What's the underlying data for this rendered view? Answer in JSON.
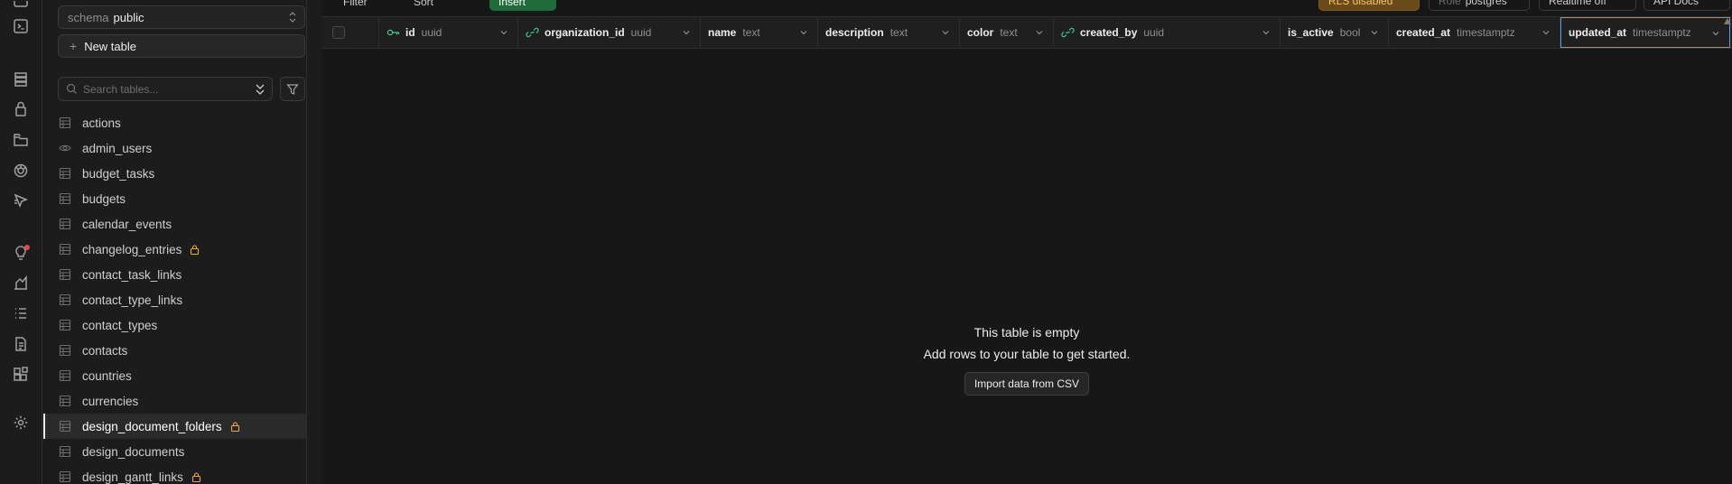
{
  "rail": {
    "icons": [
      "table-editor-icon",
      "sql-editor-icon",
      "database-icon",
      "auth-icon",
      "storage-icon",
      "realtime-icon",
      "edge-functions-icon",
      "advisors-icon",
      "reports-icon",
      "logs-icon",
      "api-docs-icon",
      "integrations-icon",
      "settings-icon"
    ],
    "alert_color": "#e5484d"
  },
  "sidebar": {
    "schema_label": "schema",
    "schema_value": "public",
    "new_table_label": "New table",
    "search_placeholder": "Search tables...",
    "tables": [
      {
        "name": "actions",
        "kind": "table",
        "locked": false,
        "active": false
      },
      {
        "name": "admin_users",
        "kind": "view",
        "locked": false,
        "active": false
      },
      {
        "name": "budget_tasks",
        "kind": "table",
        "locked": false,
        "active": false
      },
      {
        "name": "budgets",
        "kind": "table",
        "locked": false,
        "active": false
      },
      {
        "name": "calendar_events",
        "kind": "table",
        "locked": false,
        "active": false
      },
      {
        "name": "changelog_entries",
        "kind": "table",
        "locked": true,
        "active": false
      },
      {
        "name": "contact_task_links",
        "kind": "table",
        "locked": false,
        "active": false
      },
      {
        "name": "contact_type_links",
        "kind": "table",
        "locked": false,
        "active": false
      },
      {
        "name": "contact_types",
        "kind": "table",
        "locked": false,
        "active": false
      },
      {
        "name": "contacts",
        "kind": "table",
        "locked": false,
        "active": false
      },
      {
        "name": "countries",
        "kind": "table",
        "locked": false,
        "active": false
      },
      {
        "name": "currencies",
        "kind": "table",
        "locked": false,
        "active": false
      },
      {
        "name": "design_document_folders",
        "kind": "table",
        "locked": true,
        "active": true
      },
      {
        "name": "design_documents",
        "kind": "table",
        "locked": false,
        "active": false
      },
      {
        "name": "design_gantt_links",
        "kind": "table",
        "locked": true,
        "active": false
      }
    ],
    "lock_color": "#f5a623"
  },
  "toolbar": {
    "filter_label": "Filter",
    "sort_label": "Sort",
    "insert_label": "Insert",
    "rls_label": "RLS disabled",
    "role_label": "Role",
    "role_value": "postgres",
    "realtime_label": "Realtime off",
    "api_docs_label": "API Docs",
    "insert_color": "#1f6b3a",
    "rls_color": "#6b4a1a"
  },
  "grid": {
    "columns": [
      {
        "name": "id",
        "type": "uuid",
        "icon": "key-icon"
      },
      {
        "name": "organization_id",
        "type": "uuid",
        "icon": "link-icon"
      },
      {
        "name": "name",
        "type": "text",
        "icon": ""
      },
      {
        "name": "description",
        "type": "text",
        "icon": ""
      },
      {
        "name": "color",
        "type": "text",
        "icon": ""
      },
      {
        "name": "created_by",
        "type": "uuid",
        "icon": "link-icon"
      },
      {
        "name": "is_active",
        "type": "bool",
        "icon": ""
      },
      {
        "name": "created_at",
        "type": "timestamptz",
        "icon": ""
      },
      {
        "name": "updated_at",
        "type": "timestamptz",
        "icon": ""
      }
    ],
    "selected_color": "#5aa0e6"
  },
  "empty_state": {
    "title": "This table is empty",
    "subtitle": "Add rows to your table to get started.",
    "import_label": "Import data from CSV"
  }
}
